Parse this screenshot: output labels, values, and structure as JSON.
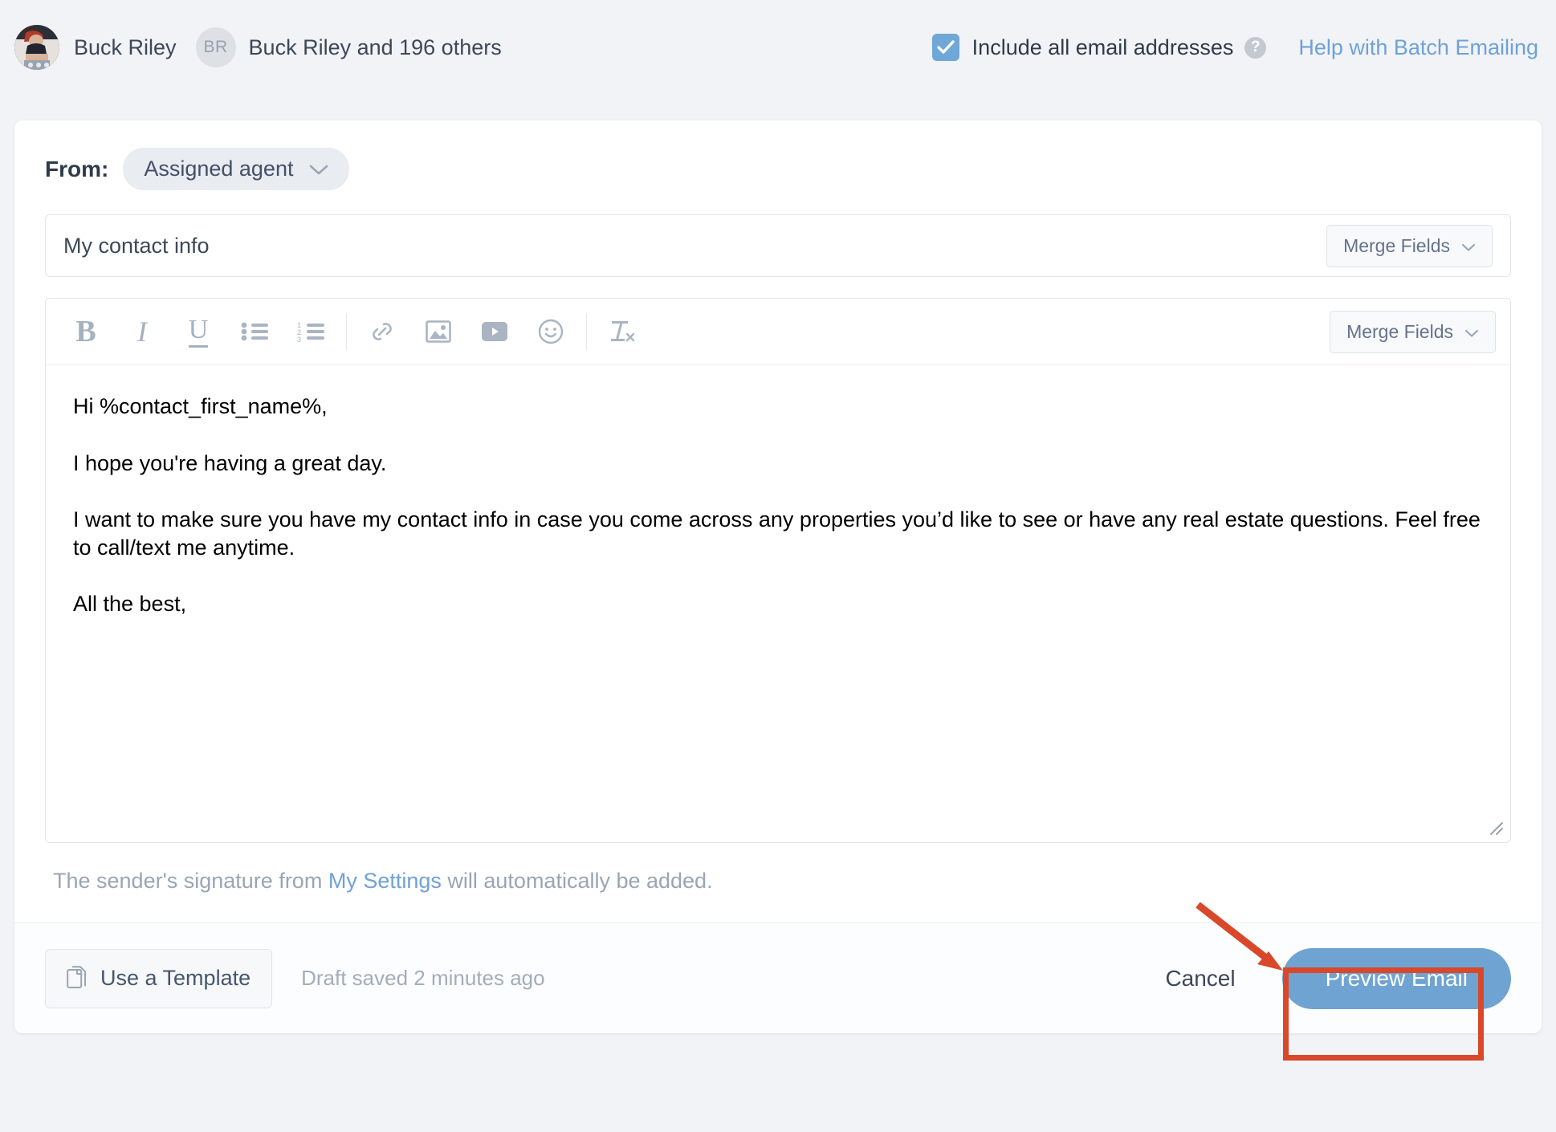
{
  "topbar": {
    "owner_name": "Buck Riley",
    "initials": "BR",
    "recipient_summary": "Buck Riley and 196 others",
    "include_all_label": "Include all email addresses",
    "help_dot": "?",
    "help_link": "Help with Batch Emailing",
    "checkbox_checked": true,
    "accent_blue": "#6fa8d6"
  },
  "compose": {
    "from_label": "From:",
    "from_value": "Assigned agent",
    "subject_value": "My contact info",
    "subject_merge_label": "Merge Fields",
    "editor_merge_label": "Merge Fields",
    "toolbar": [
      {
        "name": "bold-icon",
        "glyph": "B"
      },
      {
        "name": "italic-icon",
        "glyph": "I"
      },
      {
        "name": "underline-icon",
        "glyph": "U"
      },
      {
        "name": "bulleted-list-icon",
        "glyph": ""
      },
      {
        "name": "numbered-list-icon",
        "glyph": ""
      },
      {
        "name": "link-icon",
        "glyph": ""
      },
      {
        "name": "image-icon",
        "glyph": ""
      },
      {
        "name": "video-icon",
        "glyph": ""
      },
      {
        "name": "emoji-icon",
        "glyph": ""
      },
      {
        "name": "clear-formatting-icon",
        "glyph": ""
      }
    ],
    "body_paragraphs": [
      "Hi %contact_first_name%,",
      "I hope you're having a great day.",
      "I want to make sure you have my contact info in case you come across any properties you’d like to see or have any real estate questions. Feel free to call/text me anytime.",
      "All the best,"
    ],
    "signature_note_before": "The sender's signature from ",
    "signature_note_link": "My Settings",
    "signature_note_after": " will automatically be added."
  },
  "footer": {
    "template_label": "Use a Template",
    "draft_status": "Draft saved 2 minutes ago",
    "cancel_label": "Cancel",
    "preview_label": "Preview Email",
    "preview_color": "#6fa3d2",
    "annotation_color": "#d9482a"
  }
}
